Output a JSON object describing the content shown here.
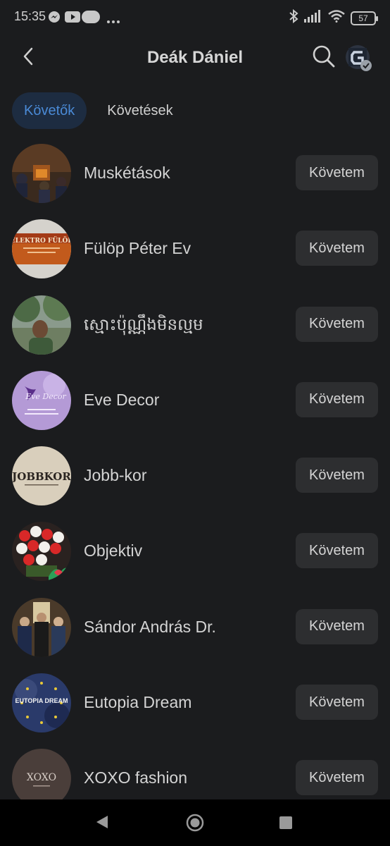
{
  "status_bar": {
    "time": "15:35",
    "battery": "57",
    "icons": [
      "messenger-icon",
      "youtube-icon",
      "pill-icon",
      "more-dots-icon",
      "bluetooth-icon",
      "signal-icon",
      "wifi-icon",
      "battery-icon"
    ]
  },
  "header": {
    "title": "Deák Dániel",
    "back_icon": "back-arrow-icon",
    "search_icon": "search-icon",
    "profile_icon": "profile-switch-icon"
  },
  "tabs": [
    {
      "label": "Követők",
      "active": true
    },
    {
      "label": "Követések",
      "active": false
    }
  ],
  "accent_color": "#4a8ad6",
  "follow_label": "Követem",
  "list": [
    {
      "name": "Muskétások",
      "button": "Követem"
    },
    {
      "name": "Fülöp Péter Ev",
      "button": "Követem",
      "avatar_text": "ELEKTRO FÜLÖP"
    },
    {
      "name": "ស្មោះប៉ុណ្ណឹងមិនល្មម",
      "button": "Követem"
    },
    {
      "name": "Eve Decor",
      "button": "Követem",
      "avatar_text": "Eve Decor"
    },
    {
      "name": "Jobb-kor",
      "button": "Követem",
      "avatar_text": "JOBBKOR"
    },
    {
      "name": "Objektiv",
      "button": "Követem"
    },
    {
      "name": "Sándor András Dr.",
      "button": "Követem"
    },
    {
      "name": "Eutopia Dream",
      "button": "Követem",
      "avatar_text": "EUTOPIA DREAM"
    },
    {
      "name": "XOXO fashion",
      "button": "Követem",
      "avatar_text": "XOXO"
    }
  ],
  "nav_bar": {
    "icons": [
      "nav-back-icon",
      "nav-home-icon",
      "nav-recents-icon"
    ]
  }
}
